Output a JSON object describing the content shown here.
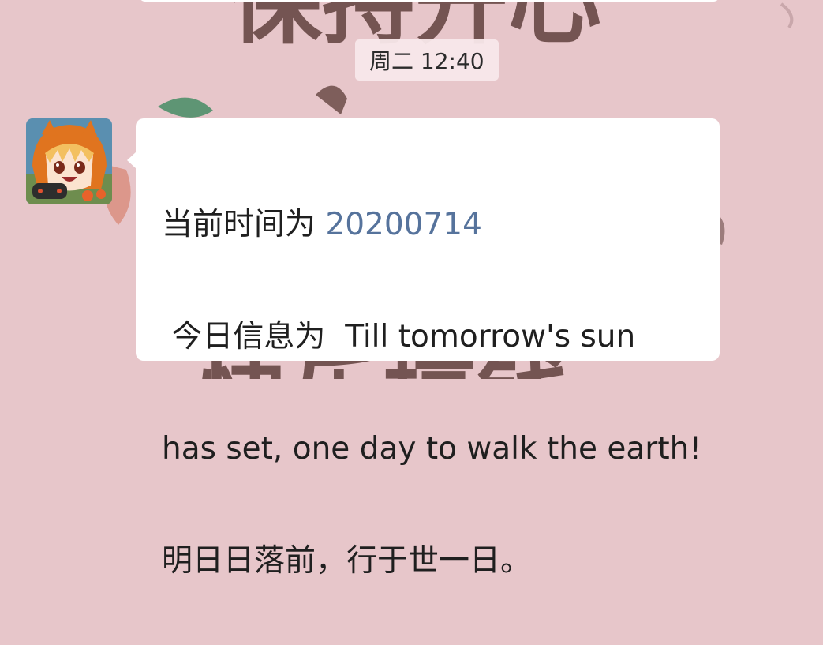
{
  "timestamp": "周二 12:40",
  "message": {
    "line1_prefix": "当前时间为 ",
    "date": "20200714",
    "line2": " 今日信息为  Till tomorrow's sun",
    "line3": "has set, one day to walk the earth!",
    "line4": "明日日落前，行于世一日。"
  },
  "wallpaper": {
    "top_text": "保持开心",
    "bottom_text": "快乐搞钱"
  },
  "colors": {
    "background": "#e7c6ca",
    "bubble": "#ffffff",
    "link_date": "#56739c"
  }
}
